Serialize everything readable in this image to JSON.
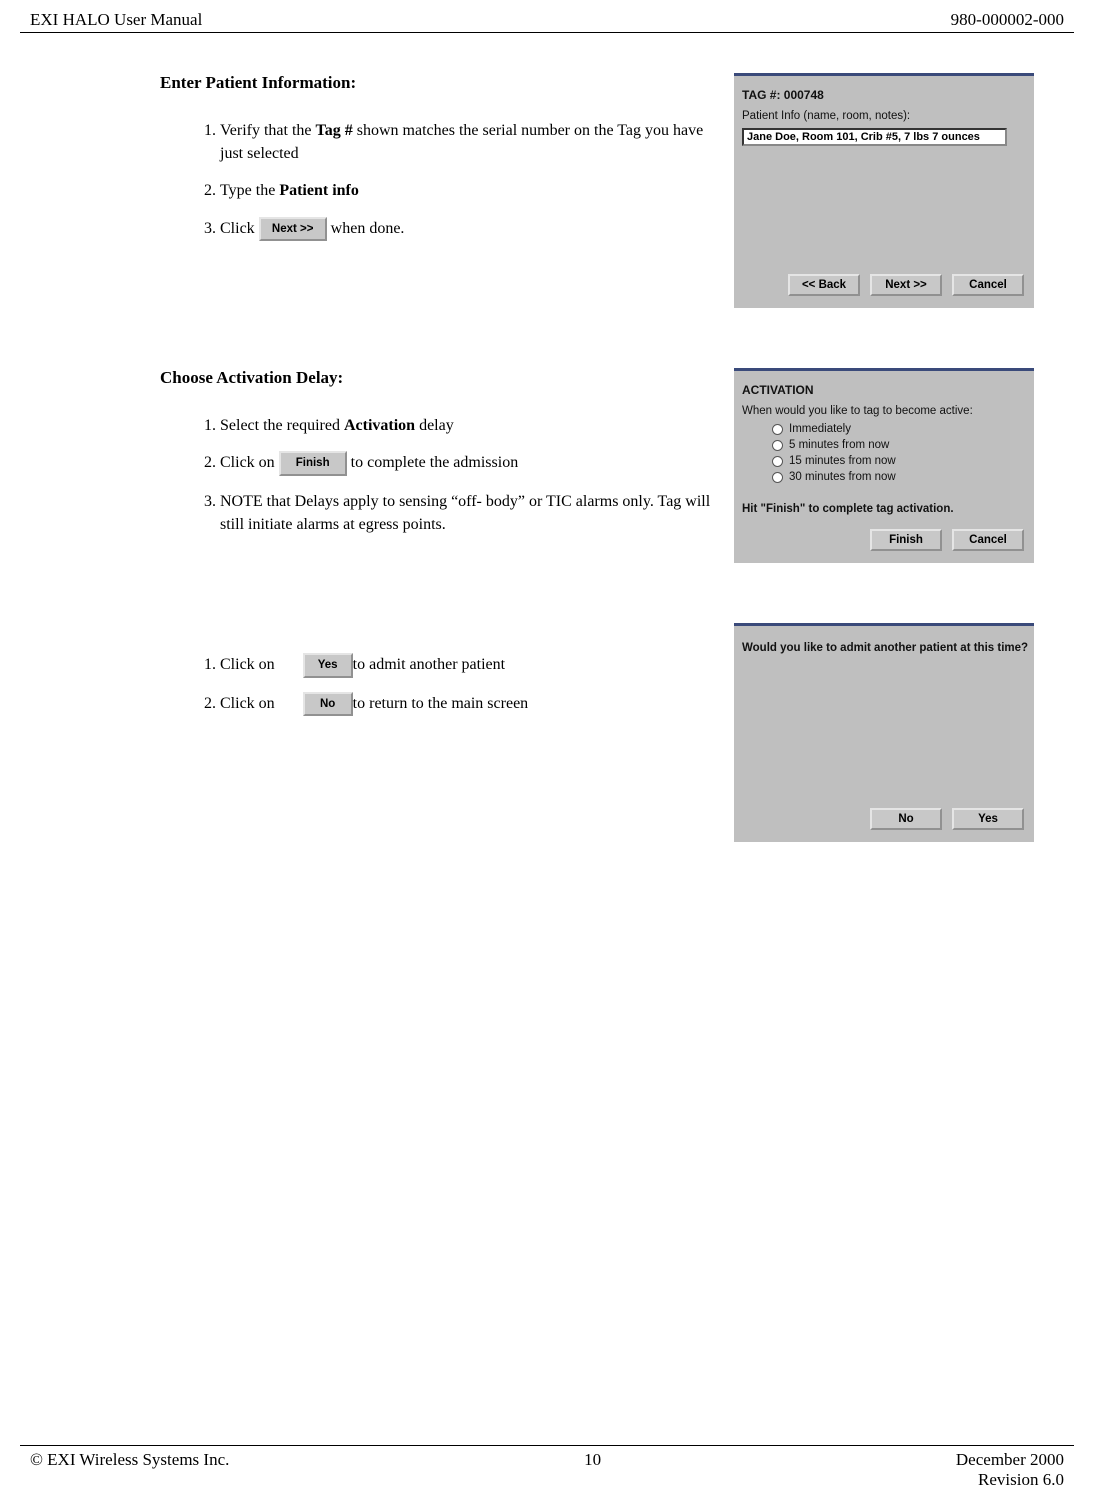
{
  "header": {
    "left": "EXI HALO User Manual",
    "right": "980-000002-000"
  },
  "section1": {
    "heading": "Enter Patient Information:",
    "steps": {
      "s1a": "Verify that the ",
      "s1b": "Tag #",
      "s1c": " shown matches the serial number on the Tag you have just selected",
      "s2a": "Type the ",
      "s2b": "Patient info",
      "s3a": "Click ",
      "s3btn": "Next >>",
      "s3b": " when done."
    },
    "dialog": {
      "tag": "TAG #: 000748",
      "label": "Patient Info (name, room, notes):",
      "input": "Jane Doe, Room 101, Crib #5, 7 lbs 7 ounces",
      "btn_back": "<< Back",
      "btn_next": "Next >>",
      "btn_cancel": "Cancel"
    }
  },
  "section2": {
    "heading": "Choose Activation Delay:",
    "steps": {
      "s1a": "Select the required ",
      "s1b": "Activation",
      "s1c": " delay",
      "s2a": "Click on  ",
      "s2btn": "Finish",
      "s2b": " to complete the admission",
      "s3": "NOTE that Delays apply to sensing “off- body” or TIC alarms only.  Tag will still initiate alarms at egress points."
    },
    "dialog": {
      "title": "ACTIVATION",
      "prompt": "When would you like to tag to become active:",
      "opt1": "Immediately",
      "opt2": "5 minutes from now",
      "opt3": "15 minutes from now",
      "opt4": "30 minutes from now",
      "hint": "Hit \"Finish\" to complete tag activation.",
      "btn_finish": "Finish",
      "btn_cancel": "Cancel"
    }
  },
  "section3": {
    "steps": {
      "s1a": "Click on ",
      "s1btn": "Yes",
      "s1b": "to admit another patient",
      "s2a": "Click on ",
      "s2btn": "No",
      "s2b": "to return to the main screen"
    },
    "dialog": {
      "prompt": "Would you like to admit another patient at this time?",
      "btn_no": "No",
      "btn_yes": "Yes"
    }
  },
  "footer": {
    "left": "© EXI Wireless Systems Inc.",
    "center": "10",
    "right1": "December 2000",
    "right2": "Revision 6.0"
  }
}
